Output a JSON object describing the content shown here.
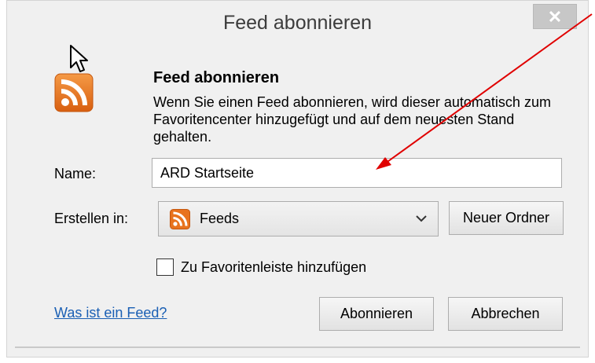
{
  "window": {
    "title": "Feed abonnieren",
    "close_glyph": "✕"
  },
  "content": {
    "heading": "Feed abonnieren",
    "description": "Wenn Sie einen Feed abonnieren, wird dieser automatisch zum Favoritencenter hinzugefügt und auf dem neuesten Stand gehalten."
  },
  "form": {
    "name_label": "Name:",
    "name_value": "ARD Startseite",
    "create_in_label": "Erstellen in:",
    "create_in_value": "Feeds",
    "new_folder_button": "Neuer Ordner",
    "favorites_bar_checkbox_label": "Zu Favoritenleiste hinzufügen",
    "favorites_bar_checked": false
  },
  "footer": {
    "help_link": "Was ist ein Feed?",
    "subscribe_button": "Abonnieren",
    "cancel_button": "Abbrechen"
  },
  "icons": {
    "feed_icon": "rss-feed-icon",
    "folder_feed_icon": "rss-feed-icon",
    "dropdown_icon": "chevron-down-icon",
    "cursor_icon": "mouse-pointer-icon",
    "annotation_arrow": "red-arrow-annotation"
  },
  "colors": {
    "rss_orange": "#e8731e",
    "link_blue": "#1a5fb4",
    "annotation_red": "#e00000",
    "window_bg": "#f0f0f0"
  }
}
